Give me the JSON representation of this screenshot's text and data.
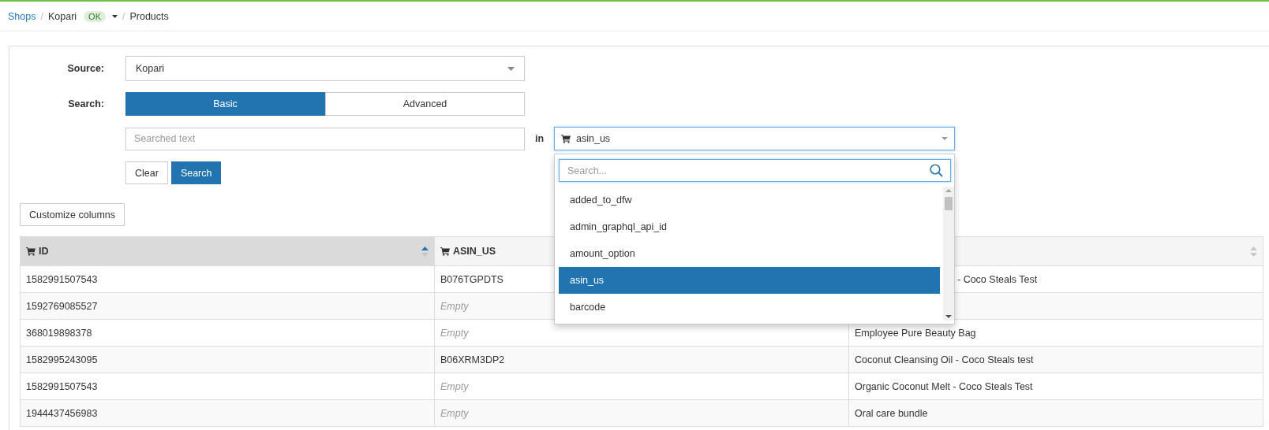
{
  "breadcrumb": {
    "items": [
      {
        "kind": "link",
        "label": "Shops"
      },
      {
        "kind": "shop",
        "separator": "/",
        "label": "Kopari",
        "badge": "OK"
      },
      {
        "kind": "current",
        "separator": "/",
        "label": "Products"
      }
    ]
  },
  "form": {
    "source": {
      "label": "Source:",
      "value": "Kopari"
    },
    "search": {
      "label": "Search:",
      "tabs": [
        {
          "label": "Basic",
          "selected": true
        },
        {
          "label": "Advanced",
          "selected": false
        }
      ],
      "text_field": {
        "placeholder": "Searched text"
      },
      "in_label": "in",
      "field_select": {
        "value": "asin_us",
        "open": true,
        "menu": {
          "search_placeholder": "Search...",
          "items": [
            {
              "label": "added_to_dfw",
              "selected": false
            },
            {
              "label": "admin_graphql_api_id",
              "selected": false
            },
            {
              "label": "amount_option",
              "selected": false
            },
            {
              "label": "asin_us",
              "selected": true
            },
            {
              "label": "barcode",
              "selected": false
            }
          ]
        }
      }
    },
    "buttons": [
      {
        "label": "Clear",
        "kind": "default"
      },
      {
        "label": "Search",
        "kind": "primary"
      }
    ]
  },
  "customize_button": "Customize columns",
  "table": {
    "columns": [
      {
        "label": "ID",
        "sorted": true
      },
      {
        "label": "ASIN_US"
      },
      {
        "sorted": false
      }
    ],
    "rows": [
      {
        "cells": [
          {
            "text": "1582991507543"
          },
          {
            "text": "B076TGPDTS"
          },
          {
            "text": "- Coco Steals Test"
          }
        ]
      },
      {
        "cells": [
          {
            "text": "1592769085527"
          },
          {
            "text": "Empty",
            "empty": true
          },
          {}
        ]
      },
      {
        "cells": [
          {
            "text": "368019898378"
          },
          {
            "text": "Empty",
            "empty": true
          },
          {
            "text": "Employee Pure Beauty Bag"
          }
        ]
      },
      {
        "cells": [
          {
            "text": "1582995243095"
          },
          {
            "text": "B06XRM3DP2"
          },
          {
            "text": "Coconut Cleansing Oil - Coco Steals test"
          }
        ]
      },
      {
        "cells": [
          {
            "text": "1582991507543"
          },
          {
            "text": "Empty",
            "empty": true
          },
          {
            "text": "Organic Coconut Melt - Coco Steals Test"
          }
        ]
      },
      {
        "cells": [
          {
            "text": "1944437456983"
          },
          {
            "text": "Empty",
            "empty": true
          },
          {
            "text": "Oral care bundle"
          }
        ]
      }
    ]
  }
}
